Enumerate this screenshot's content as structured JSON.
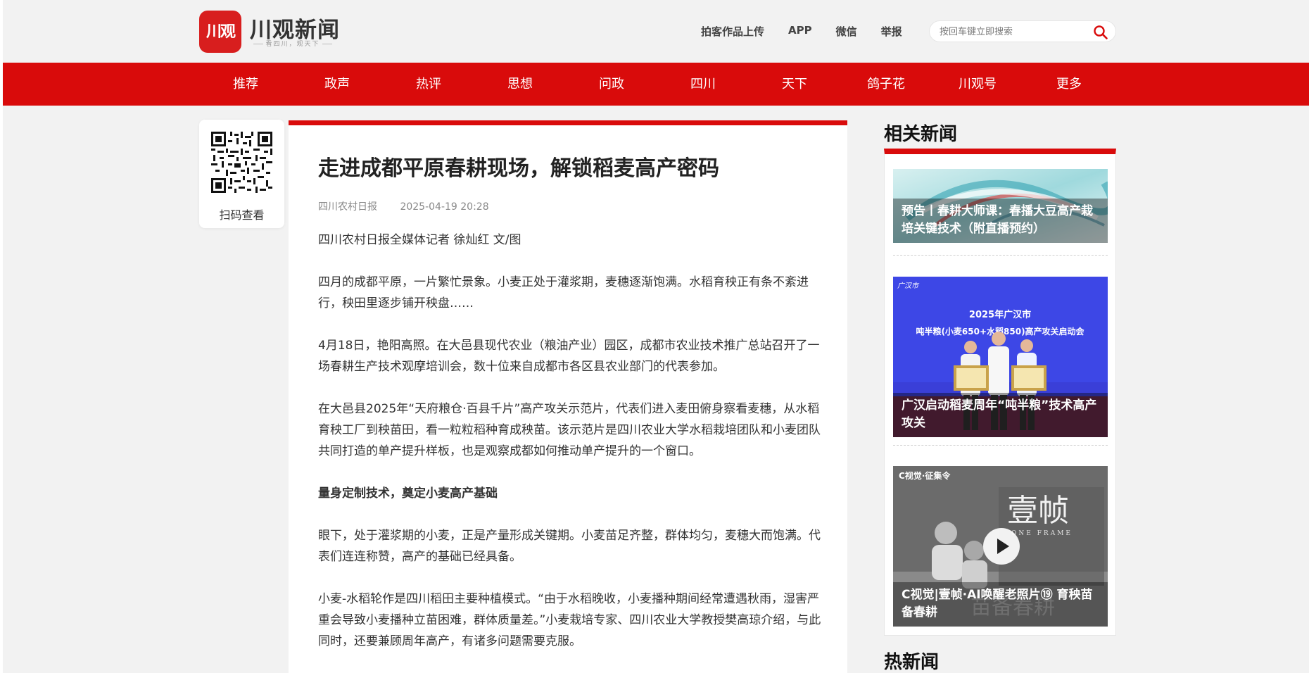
{
  "header": {
    "logo_badge": "川观",
    "logo_title": "川观新闻",
    "logo_slogan": "看四川，观天下",
    "links": [
      "拍客作品上传",
      "APP",
      "微信",
      "举报"
    ],
    "search_placeholder": "按回车键立即搜索"
  },
  "nav": {
    "items": [
      "推荐",
      "政声",
      "热评",
      "思想",
      "问政",
      "四川",
      "天下",
      "鸽子花",
      "川观号",
      "更多"
    ]
  },
  "qr": {
    "label": "扫码查看"
  },
  "article": {
    "title": "走进成都平原春耕现场，解锁稻麦高产密码",
    "source": "四川农村日报",
    "time": "2025-04-19 20:28",
    "paragraphs": [
      "四川农村日报全媒体记者 徐灿红 文/图",
      "四月的成都平原，一片繁忙景象。小麦正处于灌浆期，麦穗逐渐饱满。水稻育秧正有条不紊进行，秧田里逐步铺开秧盘……",
      "4月18日，艳阳高照。在大邑县现代农业（粮油产业）园区，成都市农业技术推广总站召开了一场春耕生产技术观摩培训会，数十位来自成都市各区县农业部门的代表参加。",
      "在大邑县2025年“天府粮仓·百县千片”高产攻关示范片，代表们进入麦田俯身察看麦穗，从水稻育秧工厂到秧苗田，看一粒粒稻种育成秧苗。该示范片是四川农业大学水稻栽培团队和小麦团队共同打造的单产提升样板，也是观察成都如何推动单产提升的一个窗口。",
      "量身定制技术，奠定小麦高产基础",
      "眼下，处于灌浆期的小麦，正是产量形成关键期。小麦苗足齐整，群体均匀，麦穗大而饱满。代表们连连称赞，高产的基础已经具备。",
      "小麦-水稻轮作是四川稻田主要种植模式。“由于水稻晚收，小麦播种期间经常遭遇秋雨，湿害严重会导致小麦播种立苗困难，群体质量差。”小麦栽培专家、四川农业大学教授樊高琼介绍，与此同时，还要兼顾周年高产，有诸多问题需要克服。"
    ]
  },
  "sidebar": {
    "title": "相关新闻",
    "items": [
      {
        "caption": "预告丨春耕大师课：春播大豆高产栽培关键技术（附直播预约）",
        "image": "abstract-swirl-banner"
      },
      {
        "caption": "广汉启动稻麦周年“吨半粮”技术高产攻关",
        "image": "launch-ceremony-photo",
        "banner_line1": "2025年广汉市",
        "banner_line2": "吨半粮(小麦650+水稻850)高产攻关启动会",
        "logo_text": "广汉市"
      },
      {
        "caption": "C视觉|壹帧·AI唤醒老照片⑲ 育秧苗备春耕",
        "image": "video-thumbnail",
        "badge": "C视觉·征集令",
        "big_text": "壹帧",
        "sub_text": "ONE FRAME",
        "overlay_text": "苗备春耕"
      }
    ],
    "hot_title": "热新闻"
  }
}
